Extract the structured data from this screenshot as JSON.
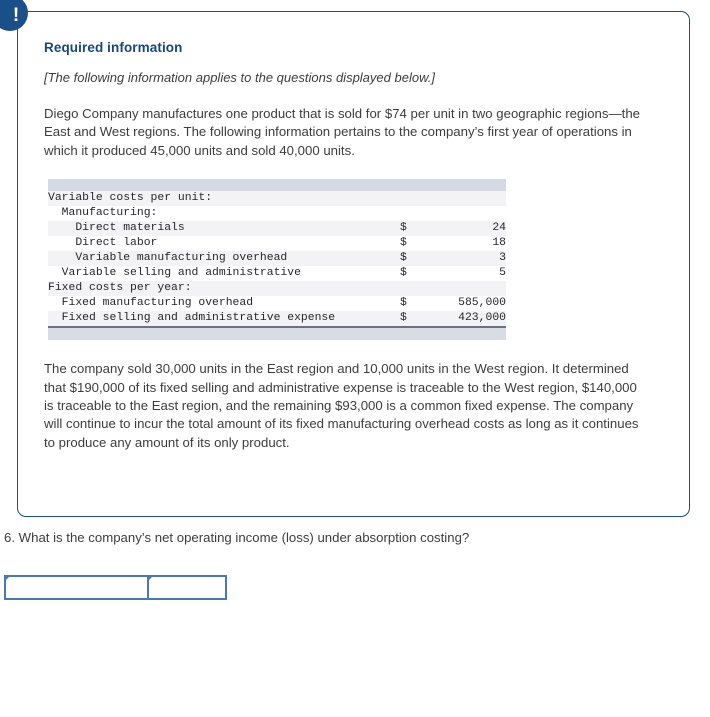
{
  "alert": {
    "icon": "exclamation-icon",
    "glyph": "!"
  },
  "card": {
    "heading": "Required information",
    "note": "[The following information applies to the questions displayed below.]",
    "intro_paragraph": "Diego Company manufactures one product that is sold for $74 per unit in two geographic regions—the East and West regions. The following information pertains to the company’s first year of operations in which it produced 45,000 units and sold 40,000 units.",
    "closing_paragraph": "The company sold 30,000 units in the East region and 10,000 units in the West region. It determined that $190,000 of its fixed selling and administrative expense is traceable to the West region, $140,000 is traceable to the East region, and the remaining $93,000 is a common fixed expense. The company will continue to incur the total amount of its fixed manufacturing overhead costs as long as it continues to produce any amount of its only product."
  },
  "cost_table": {
    "rows": [
      {
        "label": "Variable costs per unit:",
        "currency": "",
        "value": "",
        "shade": true
      },
      {
        "label": "  Manufacturing:",
        "currency": "",
        "value": "",
        "shade": false
      },
      {
        "label": "    Direct materials",
        "currency": "$",
        "value": "24",
        "shade": true
      },
      {
        "label": "    Direct labor",
        "currency": "$",
        "value": "18",
        "shade": false
      },
      {
        "label": "    Variable manufacturing overhead",
        "currency": "$",
        "value": "3",
        "shade": true
      },
      {
        "label": "  Variable selling and administrative",
        "currency": "$",
        "value": "5",
        "shade": false
      },
      {
        "label": "Fixed costs per year:",
        "currency": "",
        "value": "",
        "shade": true
      },
      {
        "label": "  Fixed manufacturing overhead",
        "currency": "$",
        "value": "585,000",
        "shade": false
      },
      {
        "label": "  Fixed selling and administrative expense",
        "currency": "$",
        "value": "423,000",
        "shade": true
      }
    ]
  },
  "question": {
    "text": "6. What is the company’s net operating income (loss) under absorption costing?"
  },
  "answer": {
    "cell1_value": "",
    "cell2_value": "",
    "cell1_placeholder": "",
    "cell2_placeholder": ""
  },
  "colors": {
    "accent_navy": "#14487f",
    "badge_navy": "#1b4f8a",
    "card_border": "#1b4f8a",
    "table_header_bar": "#d5d9e3",
    "table_stripe": "#f3f3f5",
    "input_border": "#4a7aad",
    "body_text": "#3d3d3d"
  }
}
